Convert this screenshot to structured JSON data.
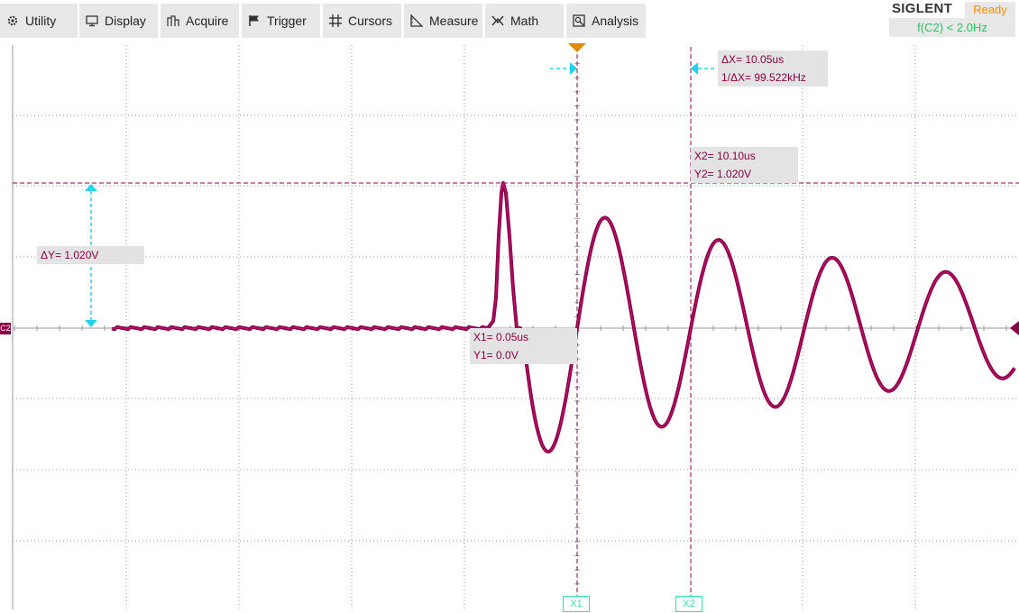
{
  "menu": [
    {
      "label": "Utility",
      "icon": "gear-icon"
    },
    {
      "label": "Display",
      "icon": "monitor-icon"
    },
    {
      "label": "Acquire",
      "icon": "acquire-icon"
    },
    {
      "label": "Trigger",
      "icon": "flag-icon"
    },
    {
      "label": "Cursors",
      "icon": "cursor-cross-icon"
    },
    {
      "label": "Measure",
      "icon": "ruler-icon"
    },
    {
      "label": "Math",
      "icon": "math-icon"
    },
    {
      "label": "Analysis",
      "icon": "analysis-icon"
    }
  ],
  "brand": {
    "logo": "SIGLENT",
    "status": "Ready",
    "freq": "f(C2) < 2.0Hz"
  },
  "cursors": {
    "delta_x": "ΔX= 10.05us",
    "inv_delta_x": "1/ΔX= 99.522kHz",
    "x2": "X2= 10.10us",
    "y2": "Y2= 1.020V",
    "x1": "X1= 0.05us",
    "y1": "Y1= 0.0V",
    "delta_y": "ΔY= 1.020V",
    "x1_marker": "X1",
    "x2_marker": "X2"
  },
  "channel": {
    "label": "C2",
    "color": "#8b0045"
  },
  "colors": {
    "trace": "#8b0045",
    "cursor_arrow": "#22d3ee",
    "grid": "#9a9a9a",
    "marker": "#2ee8a0",
    "trigger": "#e08a00"
  }
}
